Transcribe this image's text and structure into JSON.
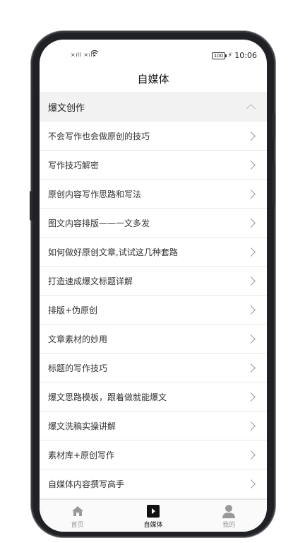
{
  "status_bar": {
    "signal": "×ıll ×ıll",
    "battery": "100",
    "time": "10:06"
  },
  "header": {
    "title": "自媒体"
  },
  "section": {
    "title": "爆文创作"
  },
  "articles": [
    "不会写作也会做原创的技巧",
    "写作技巧解密",
    "原创内容写作思路和写法",
    "图文内容排版——一文多发",
    "如何做好原创文章,试试这几种套路",
    "打造速成爆文标题详解",
    "排版+伪原创",
    "文章素材的妙用",
    "标题的写作技巧",
    "爆文思路模板，跟着做就能爆文",
    "爆文洗稿实操讲解",
    "素材库+原创写作",
    "自媒体内容撰写高手"
  ],
  "tabs": [
    {
      "label": "首页",
      "icon": "home-icon"
    },
    {
      "label": "自媒体",
      "icon": "play-icon"
    },
    {
      "label": "我的",
      "icon": "user-icon"
    }
  ],
  "colors": {
    "background": "#ffffff",
    "section_bg": "#f2f2f2",
    "tab_active": "#111111",
    "tab_inactive": "#999999"
  }
}
